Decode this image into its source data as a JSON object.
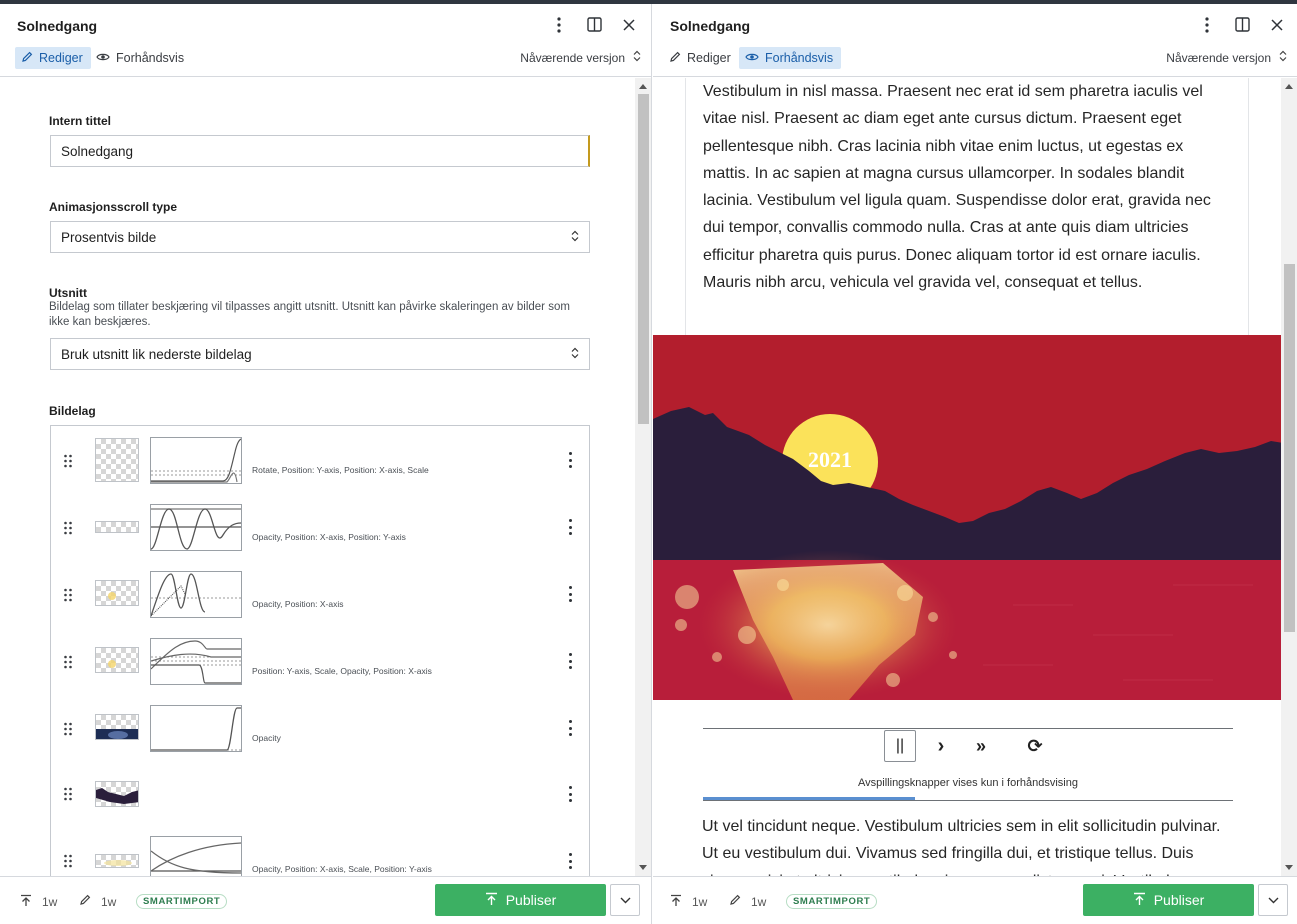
{
  "left": {
    "title": "Solnedgang",
    "tabs": [
      {
        "label": "Rediger",
        "active": true
      },
      {
        "label": "Forhåndsvis",
        "active": false
      }
    ],
    "version_label": "Nåværende versjon",
    "form": {
      "intern_tittel_label": "Intern tittel",
      "intern_tittel_value": "Solnedgang",
      "scroll_type_label": "Animasjonsscroll type",
      "scroll_type_value": "Prosentvis bilde",
      "utsnitt_label": "Utsnitt",
      "utsnitt_hint": "Bildelag som tillater beskjæring vil tilpasses angitt utsnitt. Utsnitt kan påvirke skaleringen av bilder som ikke kan beskjæres.",
      "utsnitt_value": "Bruk utsnitt lik nederste bildelag",
      "bildelag_label": "Bildelag",
      "layers": [
        {
          "description": "Rotate, Position: Y-axis, Position: X-axis, Scale"
        },
        {
          "description": "Opacity, Position: X-axis, Position: Y-axis"
        },
        {
          "description": "Opacity, Position: X-axis"
        },
        {
          "description": "Position: Y-axis, Scale, Opacity, Position: X-axis"
        },
        {
          "description": "Opacity"
        },
        {
          "description": ""
        },
        {
          "description": "Opacity, Position: X-axis, Scale, Position: Y-axis"
        }
      ]
    },
    "footer": {
      "published_age": "1w",
      "edited_age": "1w",
      "badge": "SMARTIMPORT",
      "publish_label": "Publiser"
    }
  },
  "right": {
    "title": "Solnedgang",
    "tabs": [
      {
        "label": "Rediger",
        "active": false
      },
      {
        "label": "Forhåndsvis",
        "active": true
      }
    ],
    "version_label": "Nåværende versjon",
    "paragraph_top": "Vestibulum in nisl massa. Praesent nec erat id sem pharetra iaculis vel vitae nisl. Praesent ac diam eget ante cursus dictum. Praesent eget pellentesque nibh. Cras lacinia nibh vitae enim luctus, ut egestas ex mattis. In ac sapien at magna cursus ullamcorper. In sodales blandit lacinia. Vestibulum vel ligula quam. Suspendisse dolor erat, gravida nec dui tempor, convallis commodo nulla. Cras at ante quis diam ultricies efficitur pharetra quis purus. Donec aliquam tortor id est ornare iaculis. Mauris nibh arcu, vehicula vel gravida vel, consequat et tellus.",
    "sun_text": "2021",
    "controls": {
      "pause_symbol": "||",
      "step_symbol": "›",
      "skip_symbol": "»",
      "replay_symbol": "⟳",
      "note": "Avspillingsknapper vises kun i forhåndsvising",
      "progress": 0.4
    },
    "paragraph_bottom": "Ut vel tincidunt neque. Vestibulum ultricies sem in elit sollicitudin pulvinar. Ut eu vestibulum dui. Vivamus sed fringilla dui, et tristique tellus. Duis viverra, nisi at ultricies vestibulum ipsum, non dictum orci. Vestibulum",
    "footer": {
      "published_age": "1w",
      "edited_age": "1w",
      "badge": "SMARTIMPORT",
      "publish_label": "Publiser"
    }
  },
  "colors": {
    "accent": "#d7e7f7",
    "publish_green": "#3cb063",
    "sky_red": "#b31e2d",
    "mountain": "#2a1e3b",
    "water": "#b81e3a",
    "sun": "#fbe25a"
  },
  "icons": [
    "pencil-icon",
    "eye-icon",
    "kebab-icon",
    "split-view-icon",
    "close-icon",
    "sort-icon",
    "upload-icon",
    "drag-handle-icon",
    "chevron-down-icon"
  ]
}
